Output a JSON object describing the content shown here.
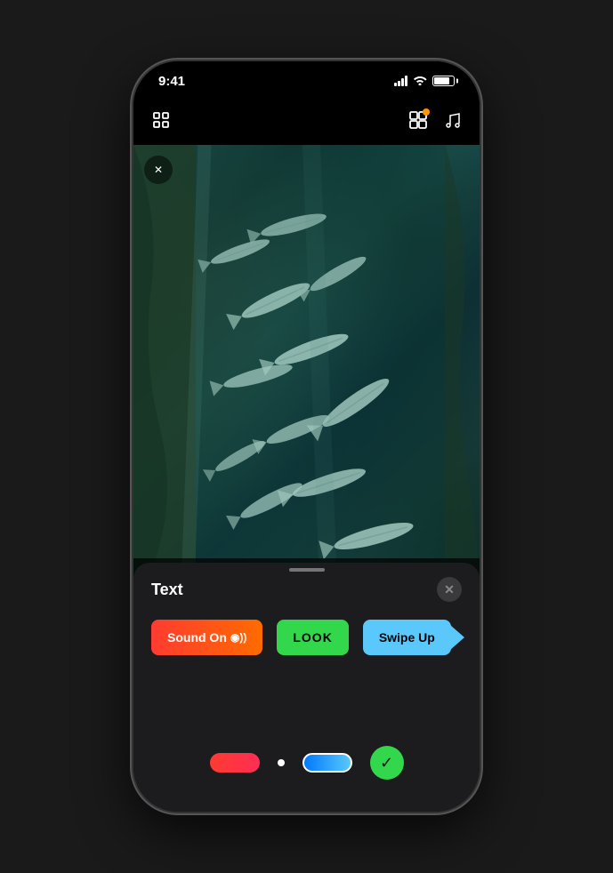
{
  "statusBar": {
    "time": "9:41",
    "batteryLevel": 80
  },
  "toolbar": {
    "leftIcon": "layers-icon",
    "centerIcon": "grid-icon",
    "rightIcon": "music-icon"
  },
  "mediaArea": {
    "closeButton": "✕"
  },
  "stickerBar": {
    "icons": [
      "memoji-icon",
      "colors-icon",
      "chat-icon",
      "photos-icon",
      "text-icon",
      "shapes-icon",
      "emoji-icon"
    ]
  },
  "bottomPanel": {
    "title": "Text",
    "closeLabel": "✕",
    "stickers": [
      {
        "label": "Sound On",
        "type": "sound-on"
      },
      {
        "label": "LOOK",
        "type": "look"
      },
      {
        "label": "Swipe Up",
        "type": "swipe-up"
      }
    ]
  }
}
